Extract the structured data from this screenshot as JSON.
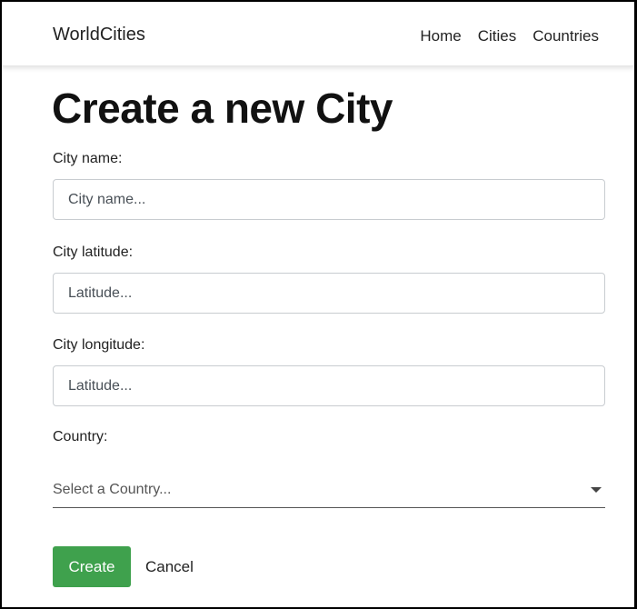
{
  "navbar": {
    "brand": "WorldCities",
    "links": [
      "Home",
      "Cities",
      "Countries"
    ]
  },
  "page": {
    "title": "Create a new City"
  },
  "form": {
    "name": {
      "label": "City name:",
      "placeholder": "City name..."
    },
    "latitude": {
      "label": "City latitude:",
      "placeholder": "Latitude..."
    },
    "longitude": {
      "label": "City longitude:",
      "placeholder": "Latitude..."
    },
    "country": {
      "label": "Country:",
      "placeholder": "Select a Country..."
    },
    "actions": {
      "create_label": "Create",
      "cancel_label": "Cancel"
    }
  },
  "colors": {
    "create_button": "#3fa14d"
  }
}
